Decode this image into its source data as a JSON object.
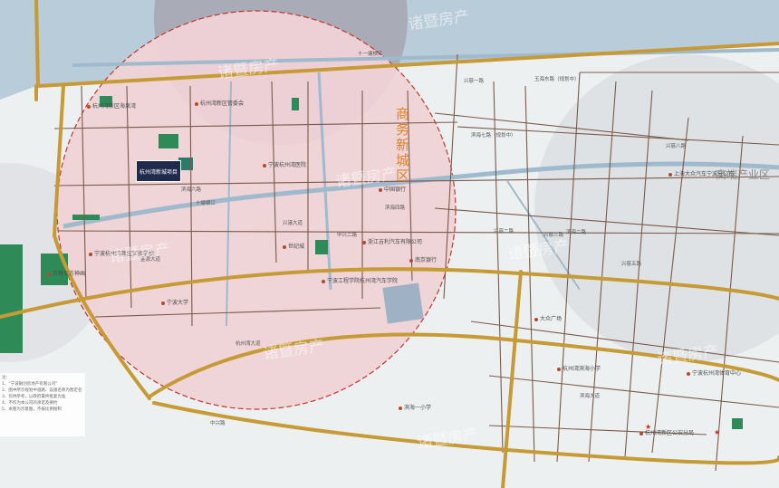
{
  "zones": {
    "business_district": "商务新城区",
    "high_end_industry": "高端产业区"
  },
  "project_label": "杭州湾新城项目",
  "watermark": "诸暨房产",
  "road_labels": [
    {
      "id": "r1",
      "text": "十一塘横江"
    },
    {
      "id": "r2",
      "text": "玉海东路（规划中）"
    },
    {
      "id": "r3",
      "text": "滨海七路（规划中）"
    },
    {
      "id": "r4",
      "text": "滨海六路"
    },
    {
      "id": "r5",
      "text": "十塘横江"
    },
    {
      "id": "r6",
      "text": "滨海四路"
    },
    {
      "id": "r7",
      "text": "兴慈一路"
    },
    {
      "id": "r8",
      "text": "兴慈二路"
    },
    {
      "id": "r9",
      "text": "兴慈三路"
    },
    {
      "id": "r10",
      "text": "兴慈五路"
    },
    {
      "id": "r11",
      "text": "兴慈八路"
    },
    {
      "id": "r12",
      "text": "滨海二路"
    },
    {
      "id": "r13",
      "text": "滨海大道"
    },
    {
      "id": "r14",
      "text": "杭州湾大道"
    },
    {
      "id": "r15",
      "text": "中兴路"
    },
    {
      "id": "r16",
      "text": "金源大道"
    },
    {
      "id": "r17",
      "text": "兴港大道"
    },
    {
      "id": "r18",
      "text": "中兴二路"
    }
  ],
  "pois": [
    {
      "id": "p1",
      "text": "杭州湾新区管委会"
    },
    {
      "id": "p2",
      "text": "宁波杭州湾医院"
    },
    {
      "id": "p3",
      "text": "世纪城"
    },
    {
      "id": "p4",
      "text": "杭州湾新区海泉湾"
    },
    {
      "id": "p5",
      "text": "宁波杭州湾新区实验学校"
    },
    {
      "id": "p6",
      "text": "宁波大学"
    },
    {
      "id": "p7",
      "text": "宁波工程学院杭州湾汽车学院"
    },
    {
      "id": "p8",
      "text": "浙江吉利汽车有限公司"
    },
    {
      "id": "p9",
      "text": "上海大众汽车宁波分公司"
    },
    {
      "id": "p10",
      "text": "杭州湾滨海小学"
    },
    {
      "id": "p11",
      "text": "滨海一小学"
    },
    {
      "id": "p12",
      "text": "中国银行"
    },
    {
      "id": "p13",
      "text": "南京银行"
    },
    {
      "id": "p14",
      "text": "杭州湾新区公安分局"
    },
    {
      "id": "p15",
      "text": "宁波杭州湾体育中心"
    },
    {
      "id": "p16",
      "text": "大众广场"
    },
    {
      "id": "p17",
      "text": "方特东方神画"
    }
  ],
  "disclaimer": [
    "注：",
    "1、“宁波融创房地产有限公司”",
    "2、图中所示规划中道路、设施名称为暂定名",
    "3、仅供参考，以政府最终批复为准",
    "4、不作为本公司的承诺及要约",
    "5、本图为示意图，不按比例绘制"
  ],
  "colors": {
    "water": "#b9ccd9",
    "land": "#edf0f1",
    "district": "#efd2d6",
    "road": "#c69a35",
    "minor_road": "#7a5a4a",
    "green": "#2e8b57",
    "project": "#1f2b4d",
    "zone_title": "#e0821e"
  }
}
